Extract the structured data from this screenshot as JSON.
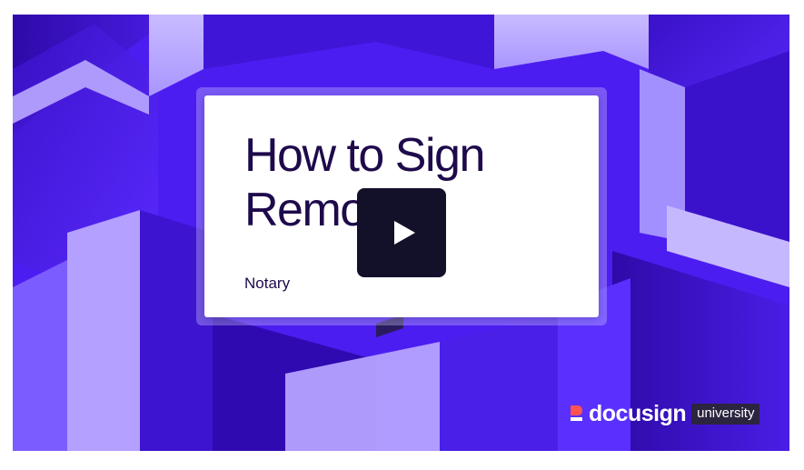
{
  "video": {
    "title": "How to Sign\nRemotely",
    "subtitle": "Notary",
    "play_icon": "play-icon"
  },
  "brand": {
    "wordmark": "docusign",
    "tag": "university",
    "icon": "docusign-logo-icon"
  },
  "colors": {
    "background": "#4c1df0",
    "card": "#ffffff",
    "title_text": "#1e0a4b",
    "play_button": "#13112a",
    "logo_accent": "#ff5252"
  }
}
